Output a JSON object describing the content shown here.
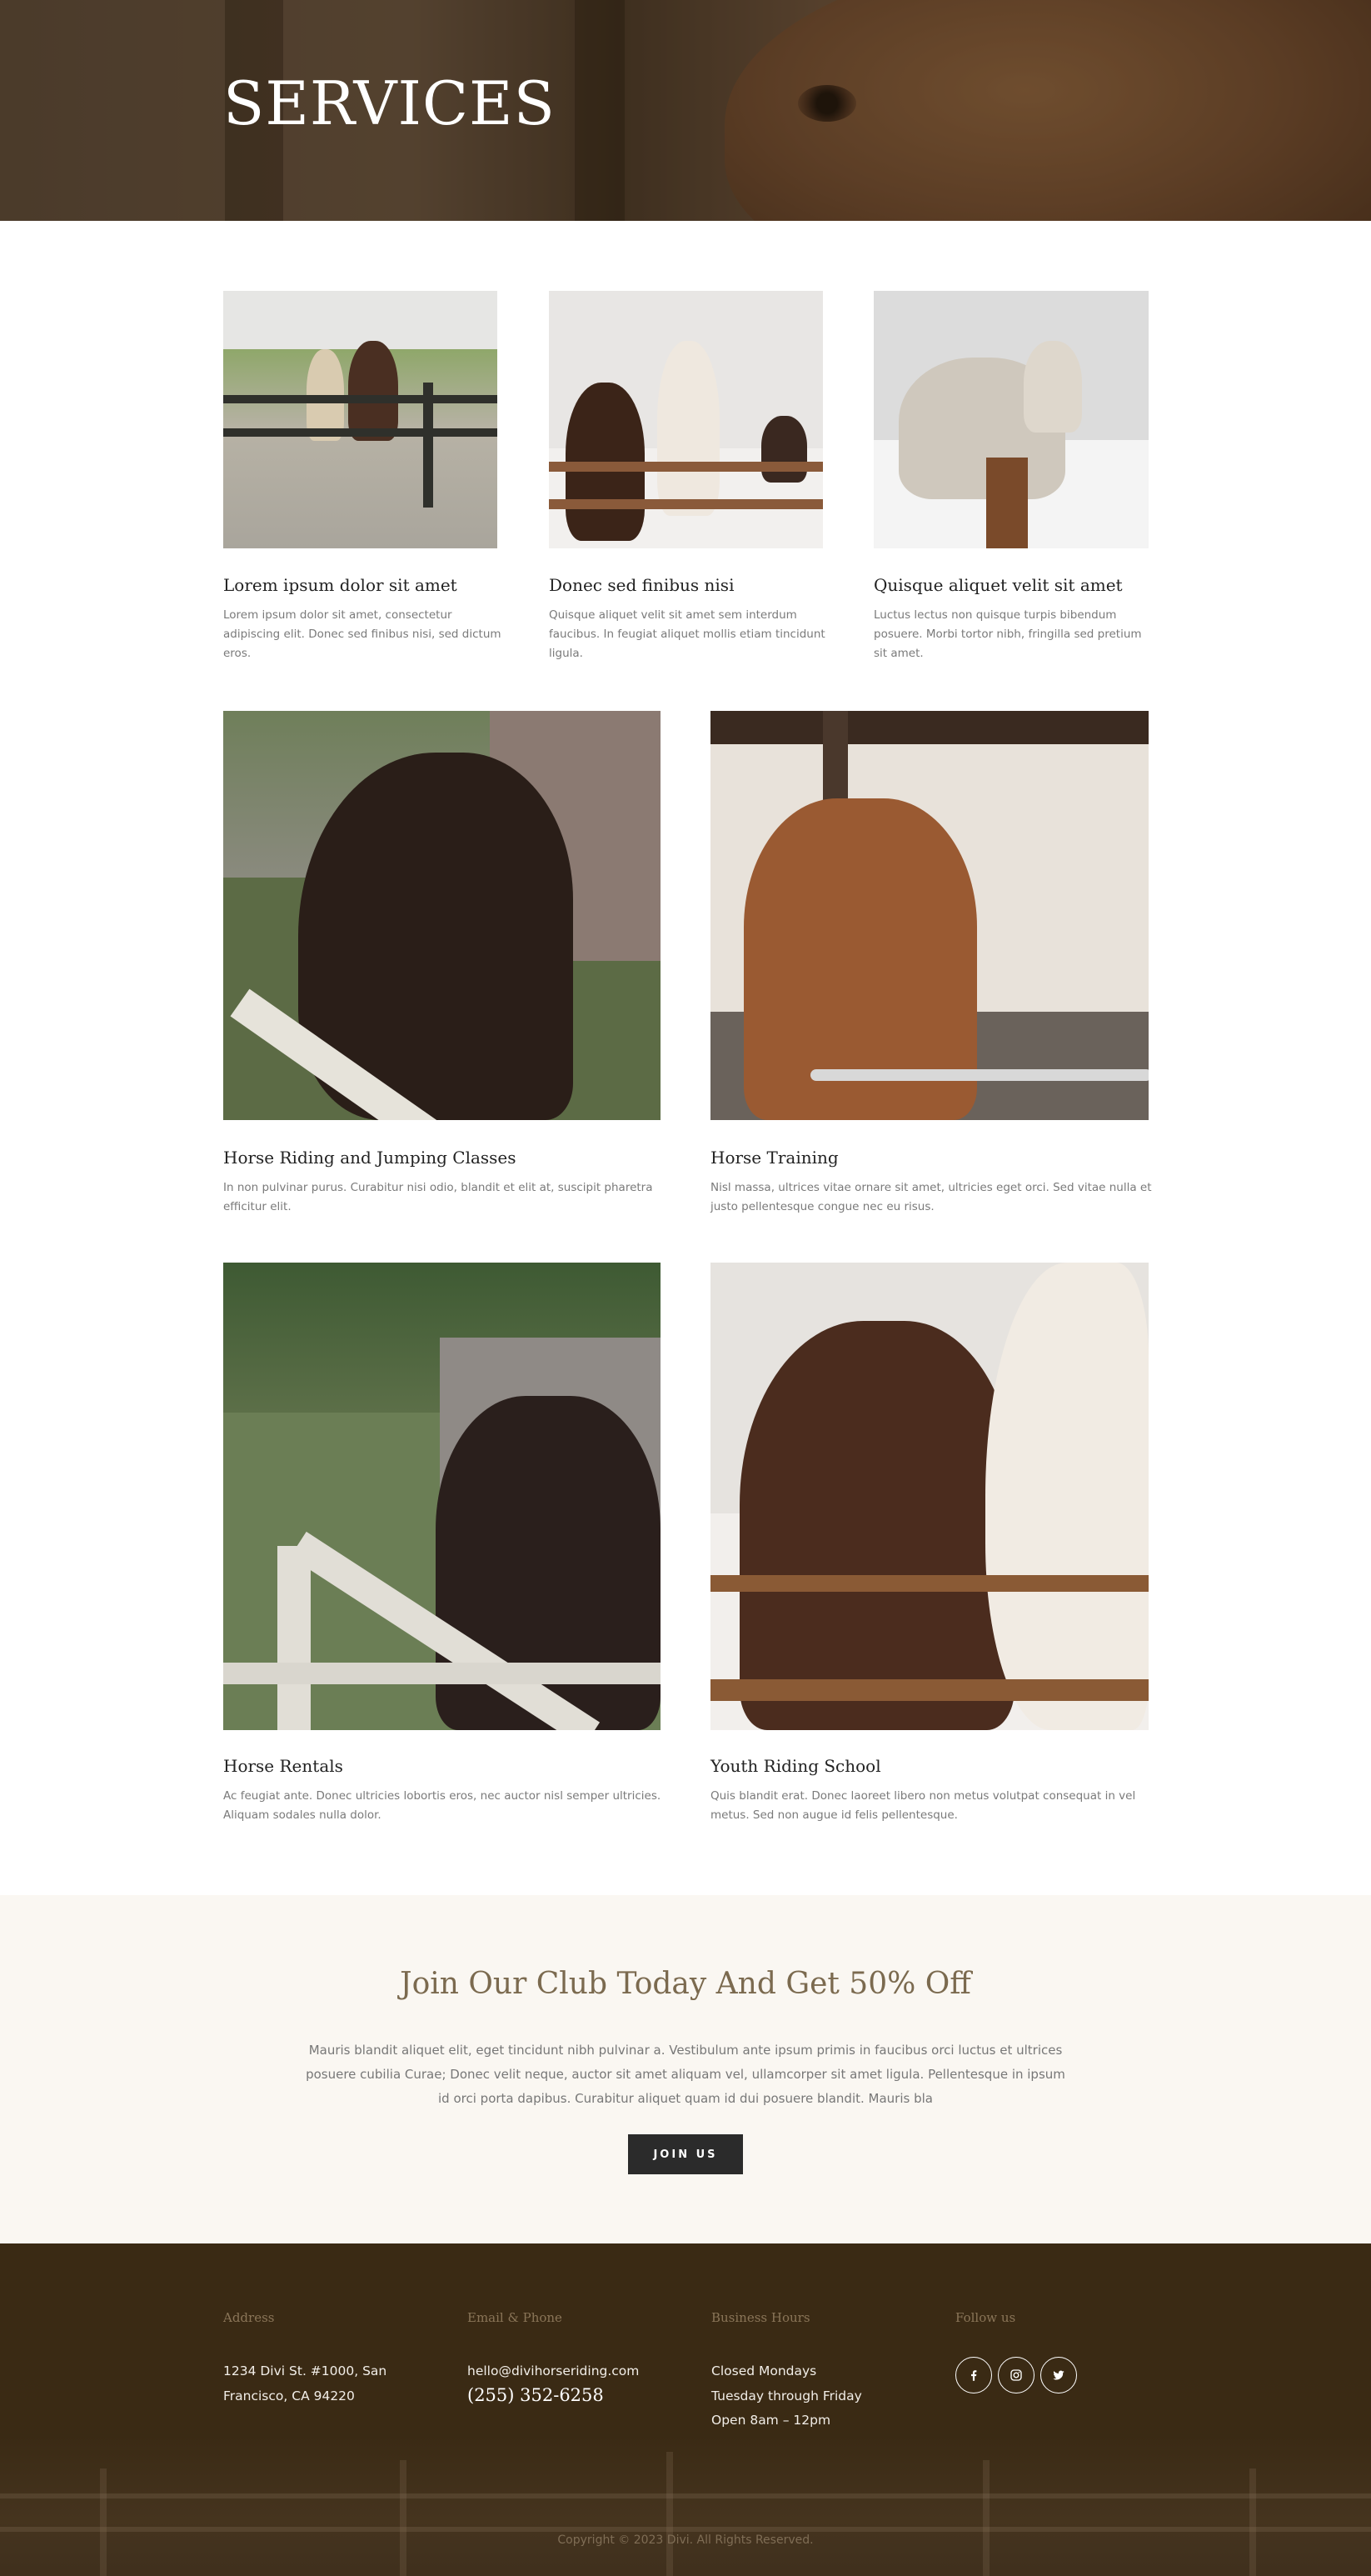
{
  "hero": {
    "title": "SERVICES"
  },
  "services_row1": [
    {
      "title": "Lorem ipsum dolor sit amet",
      "text_lines": [
        "Lorem ipsum dolor sit amet, consectetur",
        "adipiscing elit. Donec sed finibus nisi, sed dictum",
        "eros."
      ]
    },
    {
      "title": "Donec sed finibus nisi",
      "text_lines": [
        "Quisque aliquet velit sit amet sem interdum",
        "faucibus. In feugiat aliquet mollis etiam tincidunt",
        "ligula."
      ]
    },
    {
      "title": "Quisque aliquet velit sit amet",
      "text_lines": [
        "Luctus lectus non quisque turpis bibendum",
        "posuere. Morbi tortor nibh, fringilla sed pretium",
        "sit amet."
      ]
    }
  ],
  "services_row2": [
    {
      "title": "Horse Riding and Jumping Classes",
      "text_lines": [
        "In non pulvinar purus. Curabitur nisi odio, blandit et elit at, suscipit pharetra",
        "efficitur elit."
      ]
    },
    {
      "title": "Horse Training",
      "text_lines": [
        "Nisl massa, ultrices vitae ornare sit amet, ultricies eget orci. Sed vitae nulla et",
        "justo pellentesque congue nec eu risus."
      ]
    }
  ],
  "services_row3": [
    {
      "title": "Horse Rentals",
      "text_lines": [
        "Ac feugiat ante. Donec ultricies lobortis eros, nec auctor nisl semper ultricies.",
        "Aliquam sodales nulla dolor."
      ]
    },
    {
      "title": "Youth Riding School",
      "text_lines": [
        "Quis blandit erat. Donec laoreet libero non metus volutpat consequat in vel",
        "metus. Sed non augue id felis pellentesque."
      ]
    }
  ],
  "cta": {
    "title": "Join Our Club Today And Get 50% Off",
    "text_lines": [
      "Mauris blandit aliquet elit, eget tincidunt nibh pulvinar a. Vestibulum ante ipsum primis in faucibus orci luctus et ultrices",
      "posuere cubilia Curae; Donec velit neque, auctor sit amet aliquam vel, ullamcorper sit amet ligula. Pellentesque in ipsum",
      "id orci porta dapibus. Curabitur aliquet quam id dui posuere blandit. Mauris bla"
    ],
    "button_label": "JOIN US"
  },
  "footer": {
    "address_heading": "Address",
    "address_line1": "1234 Divi St. #1000, San",
    "address_line2": "Francisco, CA 94220",
    "contact_heading": "Email & Phone",
    "email": "hello@divihorseriding.com",
    "phone": "(255) 352-6258",
    "hours_heading": "Business Hours",
    "hours_line1": "Closed Mondays",
    "hours_line2": "Tuesday through Friday",
    "hours_line3": "Open 8am – 12pm",
    "follow_heading": "Follow us",
    "social_icons": [
      "facebook-icon",
      "instagram-icon",
      "twitter-icon"
    ],
    "copyright": "Copyright © 2023 Divi. All Rights Reserved."
  },
  "colors": {
    "hero_overlay": "#5e4d3d",
    "cta_background": "#faf7f2",
    "cta_title": "#7b6a4f",
    "button": "#2b2b2b",
    "footer_background": "#3a2a14",
    "footer_heading": "#8a7558"
  }
}
